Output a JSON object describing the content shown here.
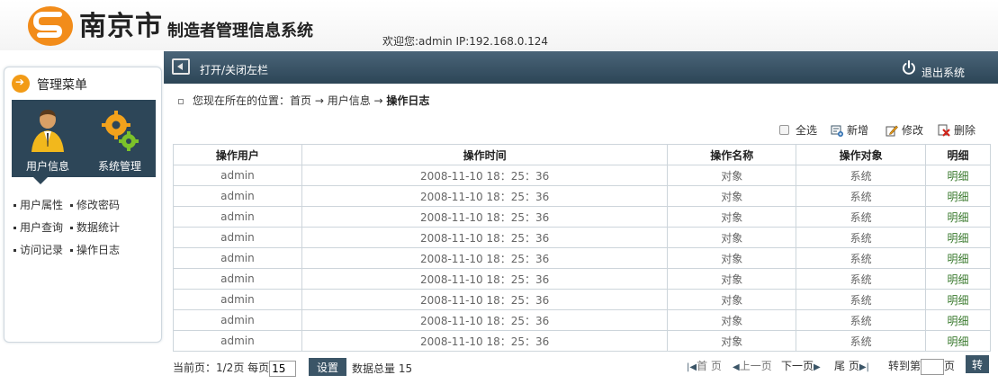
{
  "header": {
    "city": "南京市",
    "system_title": "制造者管理信息系统",
    "welcome": "欢迎您:admin IP:192.168.0.124"
  },
  "topbar": {
    "toggle_label": "打开/关闭左栏",
    "logout_label": "退出系统"
  },
  "sidebar": {
    "title": "管理菜单",
    "tiles": [
      {
        "label": "用户信息",
        "icon": "user-icon"
      },
      {
        "label": "系统管理",
        "icon": "gears-icon"
      }
    ],
    "links": [
      "用户属性",
      "修改密码",
      "用户查询",
      "数据统计",
      "访问记录",
      "操作日志"
    ]
  },
  "breadcrumb": {
    "prefix": "您现在所在的位置：",
    "home": "首页",
    "arrow1": " → ",
    "level2": "用户信息",
    "arrow2": " → ",
    "current": "操作日志"
  },
  "toolbar": {
    "select_all": "全选",
    "add": "新增",
    "edit": "修改",
    "delete": "删除"
  },
  "table": {
    "headers": [
      "操作用户",
      "操作时间",
      "操作名称",
      "操作对象",
      "明细"
    ],
    "rows": [
      [
        "admin",
        "2008-11-10 18：25：36",
        "对象",
        "系统",
        "明细"
      ],
      [
        "admin",
        "2008-11-10 18：25：36",
        "对象",
        "系统",
        "明细"
      ],
      [
        "admin",
        "2008-11-10 18：25：36",
        "对象",
        "系统",
        "明细"
      ],
      [
        "admin",
        "2008-11-10 18：25：36",
        "对象",
        "系统",
        "明细"
      ],
      [
        "admin",
        "2008-11-10 18：25：36",
        "对象",
        "系统",
        "明细"
      ],
      [
        "admin",
        "2008-11-10 18：25：36",
        "对象",
        "系统",
        "明细"
      ],
      [
        "admin",
        "2008-11-10 18：25：36",
        "对象",
        "系统",
        "明细"
      ],
      [
        "admin",
        "2008-11-10 18：25：36",
        "对象",
        "系统",
        "明细"
      ],
      [
        "admin",
        "2008-11-10 18：25：36",
        "对象",
        "系统",
        "明细"
      ]
    ]
  },
  "pager": {
    "current_label": "当前页：1/2页 每页",
    "page_size": "15",
    "set_label": "设置",
    "total_label": "数据总量 15",
    "first": "首 页",
    "prev": "上一页",
    "next": "下一页",
    "last": "尾 页",
    "goto_prefix": "转到第",
    "goto_suffix": "页",
    "go_label": "转"
  },
  "colors": {
    "bar": "#2c4556",
    "accent": "#f29b16",
    "link_green": "#3a7a2e"
  }
}
